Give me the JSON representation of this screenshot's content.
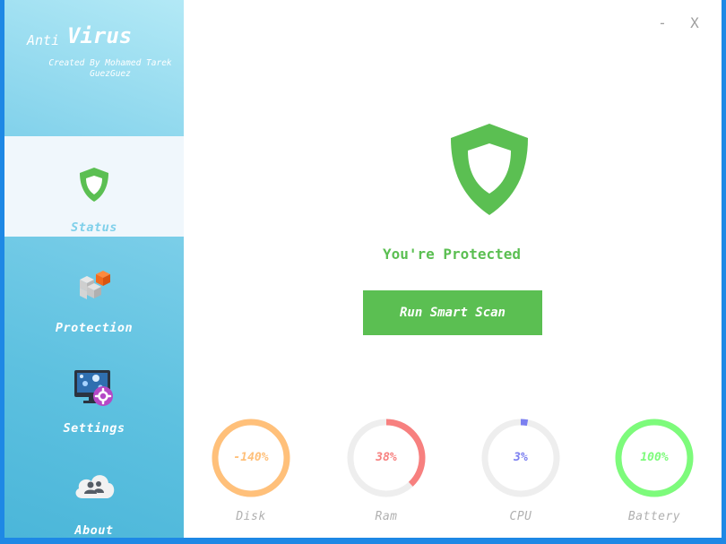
{
  "sidebar": {
    "brand": {
      "anti": "Anti",
      "virus": "Virus",
      "credit": "Created By Mohamed Tarek GuezGuez"
    },
    "items": [
      {
        "label": "Status",
        "icon": "shield-icon",
        "active": true
      },
      {
        "label": "Protection",
        "icon": "blocks-icon",
        "active": false
      },
      {
        "label": "Settings",
        "icon": "monitor-gear-icon",
        "active": false
      },
      {
        "label": "About",
        "icon": "cloud-users-icon",
        "active": false
      }
    ]
  },
  "window_controls": {
    "minimize": "-",
    "close": "X"
  },
  "main": {
    "status_text": "You're Protected",
    "scan_button": "Run Smart Scan",
    "colors": {
      "accent_green": "#5bbf52",
      "sidebar_blue": "#7fd0ea"
    }
  },
  "gauges": [
    {
      "label": "Disk",
      "value_text": "-140%",
      "fill_percent": 100,
      "color": "#ffc07a"
    },
    {
      "label": "Ram",
      "value_text": "38%",
      "fill_percent": 38,
      "color": "#f7807f"
    },
    {
      "label": "CPU",
      "value_text": "3%",
      "fill_percent": 3,
      "color": "#7b7ff0"
    },
    {
      "label": "Battery",
      "value_text": "100%",
      "fill_percent": 100,
      "color": "#7dfb7b"
    }
  ]
}
